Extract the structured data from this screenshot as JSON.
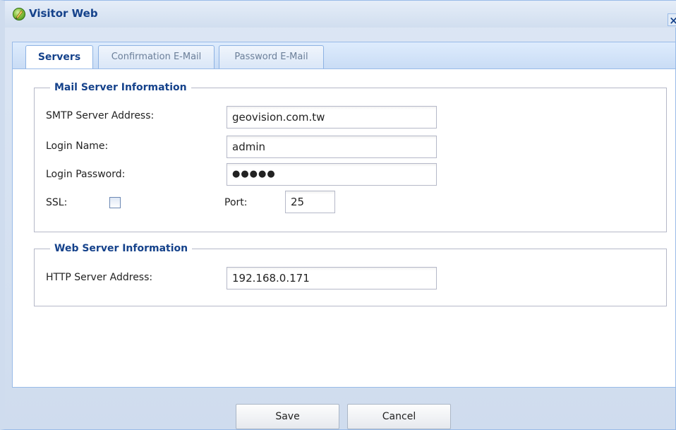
{
  "window": {
    "title": "Visitor Web",
    "close_label": "×"
  },
  "tabs": [
    {
      "label": "Servers",
      "active": true
    },
    {
      "label": "Confirmation E-Mail",
      "active": false
    },
    {
      "label": "Password E-Mail",
      "active": false
    }
  ],
  "mail_server": {
    "legend": "Mail Server Information",
    "smtp_label": "SMTP Server Address:",
    "smtp_value": "geovision.com.tw",
    "login_name_label": "Login Name:",
    "login_name_value": "admin",
    "login_password_label": "Login Password:",
    "login_password_value": "●●●●●",
    "ssl_label": "SSL:",
    "ssl_checked": false,
    "port_label": "Port:",
    "port_value": "25"
  },
  "web_server": {
    "legend": "Web Server Information",
    "http_label": "HTTP Server Address:",
    "http_value": "192.168.0.171"
  },
  "buttons": {
    "save_label": "Save",
    "cancel_label": "Cancel"
  },
  "colors": {
    "accent": "#15428b",
    "tab_border": "#8db2e3",
    "window_bg": "#cfdcee",
    "field_border": "#b5b8c8"
  }
}
